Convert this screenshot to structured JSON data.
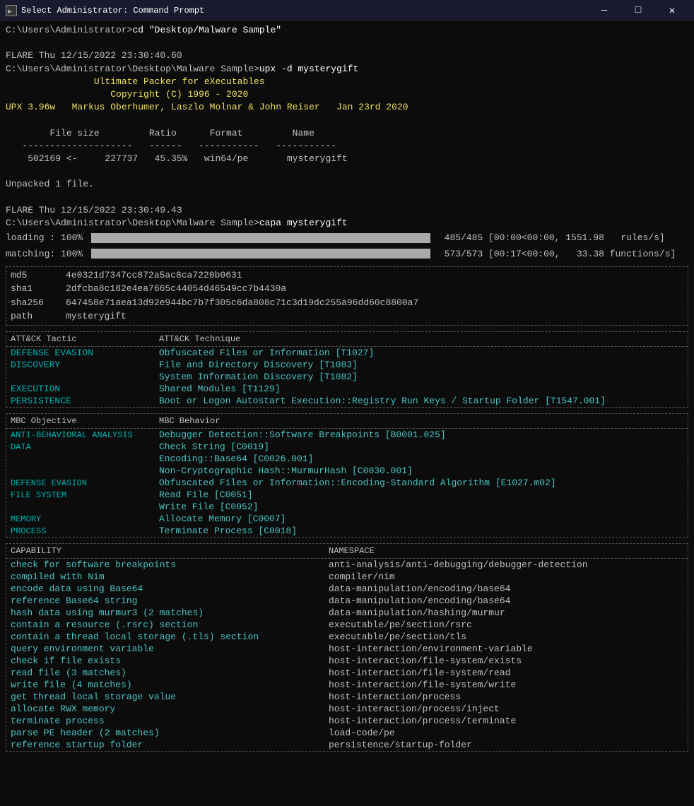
{
  "titlebar": {
    "title": "Select Administrator: Command Prompt",
    "icon": "▶",
    "min": "—",
    "max": "□",
    "close": "✕"
  },
  "terminal": {
    "lines": [
      {
        "type": "plain",
        "text": "C:\\Users\\Administrator>cd \"Desktop/Malware Sample\""
      },
      {
        "type": "plain",
        "text": ""
      },
      {
        "type": "plain",
        "text": "FLARE Thu 12/15/2022 23:30:40.60"
      },
      {
        "type": "plain",
        "text": "C:\\Users\\Administrator\\Desktop\\Malware Sample>upx -d mysterygift"
      },
      {
        "type": "yellow",
        "text": "                Ultimate Packer for eXecutables"
      },
      {
        "type": "yellow",
        "text": "                   Copyright (C) 1996 - 2020"
      },
      {
        "type": "yellow",
        "text": "UPX 3.96w   Markus Oberhumer, Laszlo Molnar & John Reiser   Jan 23rd 2020"
      },
      {
        "type": "plain",
        "text": ""
      },
      {
        "type": "plain",
        "text": "        File size         Ratio      Format         Name"
      },
      {
        "type": "plain",
        "text": "   --------------------   ------   -----------   -----------"
      },
      {
        "type": "plain",
        "text": "    502169 <-     227737   45.35%   win64/pe       mysterygift"
      },
      {
        "type": "plain",
        "text": ""
      },
      {
        "type": "plain",
        "text": "Unpacked 1 file."
      },
      {
        "type": "plain",
        "text": ""
      },
      {
        "type": "plain",
        "text": "FLARE Thu 12/15/2022 23:30:49.43"
      },
      {
        "type": "plain",
        "text": "C:\\Users\\Administrator\\Desktop\\Malware Sample>capa mysterygift"
      }
    ]
  },
  "progress": {
    "loading_label": "loading : 100%",
    "loading_stats": "485/485 [00:00<00:00, 1551.98   rules/s]",
    "matching_label": "matching: 100%",
    "matching_stats": "573/573 [00:17<00:00,   33.38 functions/s]"
  },
  "hashes": {
    "md5": {
      "key": "md5",
      "val": "4e0321d7347cc872a5ac8ca7220b0631"
    },
    "sha1": {
      "key": "sha1",
      "val": "2dfcba8c182e4ea7665c44054d46549cc7b4430a"
    },
    "sha256": {
      "key": "sha256",
      "val": "647458e71aea13d92e944bc7b7f305c6da808c71c3d19dc255a96dd60c8800a7"
    },
    "path": {
      "key": "path",
      "val": "mysterygift"
    }
  },
  "attck": {
    "col1_header": "ATT&CK Tactic",
    "col2_header": "ATT&CK Technique",
    "rows": [
      {
        "tactic": "DEFENSE EVASION",
        "technique": "Obfuscated Files or Information [T1027]"
      },
      {
        "tactic": "DISCOVERY",
        "technique": "File and Directory Discovery [T1083]"
      },
      {
        "tactic": "",
        "technique": "System Information Discovery [T1082]"
      },
      {
        "tactic": "EXECUTION",
        "technique": "Shared Modules [T1129]"
      },
      {
        "tactic": "PERSISTENCE",
        "technique": "Boot or Logon Autostart Execution::Registry Run Keys / Startup Folder [T1547.001]"
      }
    ]
  },
  "mbc": {
    "col1_header": "MBC Objective",
    "col2_header": "MBC Behavior",
    "rows": [
      {
        "obj": "ANTI-BEHAVIORAL ANALYSIS",
        "behavior": "Debugger Detection::Software Breakpoints [B0001.025]"
      },
      {
        "obj": "DATA",
        "behavior": "Check String [C0019]"
      },
      {
        "obj": "",
        "behavior": "Encoding::Base64 [C0026.001]"
      },
      {
        "obj": "",
        "behavior": "Non-Cryptographic Hash::MurmurHash [C0030.001]"
      },
      {
        "obj": "DEFENSE EVASION",
        "behavior": "Obfuscated Files or Information::Encoding-Standard Algorithm [E1027.m02]"
      },
      {
        "obj": "FILE SYSTEM",
        "behavior": "Read File [C0051]"
      },
      {
        "obj": "",
        "behavior": "Write File [C0052]"
      },
      {
        "obj": "MEMORY",
        "behavior": "Allocate Memory [C0007]"
      },
      {
        "obj": "PROCESS",
        "behavior": "Terminate Process [C0018]"
      }
    ]
  },
  "capabilities": {
    "col1_header": "CAPABILITY",
    "col2_header": "NAMESPACE",
    "rows": [
      {
        "cap": "check for software breakpoints",
        "ns": "anti-analysis/anti-debugging/debugger-detection"
      },
      {
        "cap": "compiled with Nim",
        "ns": "compiler/nim"
      },
      {
        "cap": "encode data using Base64",
        "ns": "data-manipulation/encoding/base64"
      },
      {
        "cap": "reference Base64 string",
        "ns": "data-manipulation/encoding/base64"
      },
      {
        "cap": "hash data using murmur3 (2 matches)",
        "ns": "data-manipulation/hashing/murmur"
      },
      {
        "cap": "contain a resource (.rsrc) section",
        "ns": "executable/pe/section/rsrc"
      },
      {
        "cap": "contain a thread local storage (.tls) section",
        "ns": "executable/pe/section/tls"
      },
      {
        "cap": "query environment variable",
        "ns": "host-interaction/environment-variable"
      },
      {
        "cap": "check if file exists",
        "ns": "host-interaction/file-system/exists"
      },
      {
        "cap": "read file (3 matches)",
        "ns": "host-interaction/file-system/read"
      },
      {
        "cap": "write file (4 matches)",
        "ns": "host-interaction/file-system/write"
      },
      {
        "cap": "get thread local storage value",
        "ns": "host-interaction/process"
      },
      {
        "cap": "allocate RWX memory",
        "ns": "host-interaction/process/inject"
      },
      {
        "cap": "terminate process",
        "ns": "host-interaction/process/terminate"
      },
      {
        "cap": "parse PE header (2 matches)",
        "ns": "load-code/pe"
      },
      {
        "cap": "reference startup folder",
        "ns": "persistence/startup-folder"
      }
    ]
  }
}
